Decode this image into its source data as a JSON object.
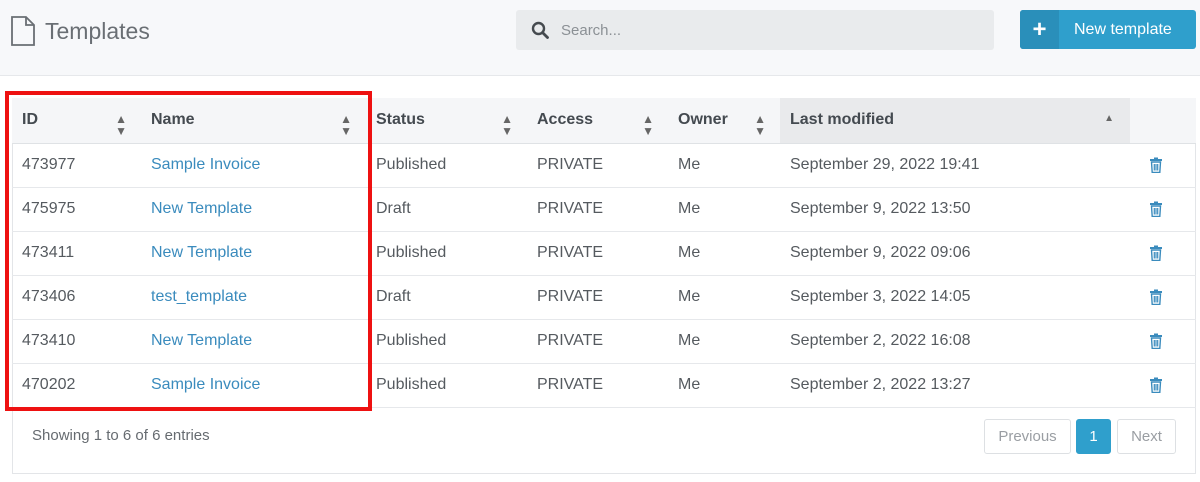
{
  "header": {
    "title": "Templates",
    "search_placeholder": "Search...",
    "new_button_label": "New template",
    "new_button_icon": "+"
  },
  "table": {
    "columns": [
      "ID",
      "Name",
      "Status",
      "Access",
      "Owner",
      "Last modified"
    ],
    "sorted_column": "Last modified",
    "sort_direction": "ascending",
    "rows": [
      {
        "id": "473977",
        "name": "Sample Invoice",
        "status": "Published",
        "access": "PRIVATE",
        "owner": "Me",
        "modified": "September 29, 2022 19:41"
      },
      {
        "id": "475975",
        "name": "New Template",
        "status": "Draft",
        "access": "PRIVATE",
        "owner": "Me",
        "modified": "September 9, 2022 13:50"
      },
      {
        "id": "473411",
        "name": "New Template",
        "status": "Published",
        "access": "PRIVATE",
        "owner": "Me",
        "modified": "September 9, 2022 09:06"
      },
      {
        "id": "473406",
        "name": "test_template",
        "status": "Draft",
        "access": "PRIVATE",
        "owner": "Me",
        "modified": "September 3, 2022 14:05"
      },
      {
        "id": "473410",
        "name": "New Template",
        "status": "Published",
        "access": "PRIVATE",
        "owner": "Me",
        "modified": "September 2, 2022 16:08"
      },
      {
        "id": "470202",
        "name": "Sample Invoice",
        "status": "Published",
        "access": "PRIVATE",
        "owner": "Me",
        "modified": "September 2, 2022 13:27"
      }
    ]
  },
  "footer": {
    "info": "Showing 1 to 6 of 6 entries",
    "previous_label": "Previous",
    "current_page": "1",
    "next_label": "Next"
  },
  "colors": {
    "accent": "#2f9fcc",
    "link": "#3a8bbd",
    "highlight": "#ee1111"
  }
}
